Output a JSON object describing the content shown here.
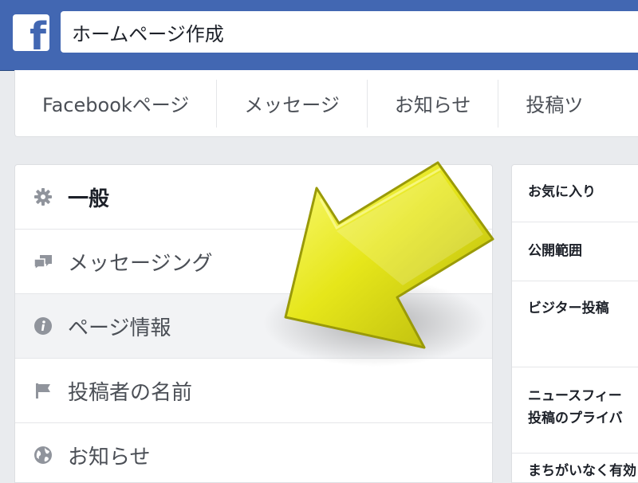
{
  "topbar": {
    "logo_letter": "f",
    "search_value": "ホームページ作成",
    "brand_color": "#4267b2"
  },
  "tabs": [
    {
      "label": "Facebookページ"
    },
    {
      "label": "メッセージ"
    },
    {
      "label": "お知らせ"
    },
    {
      "label": "投稿ツ"
    }
  ],
  "settings_menu": {
    "items": [
      {
        "label": "一般",
        "icon": "gear-icon"
      },
      {
        "label": "メッセージング",
        "icon": "chat-bubbles-icon"
      },
      {
        "label": "ページ情報",
        "icon": "info-icon"
      },
      {
        "label": "投稿者の名前",
        "icon": "flag-icon"
      },
      {
        "label": "お知らせ",
        "icon": "globe-icon"
      }
    ]
  },
  "settings_panel": {
    "rows": [
      {
        "label": "お気に入り"
      },
      {
        "label": "公開範囲"
      },
      {
        "label": "ビジター投稿"
      },
      {
        "label_line1": "ニュースフィー",
        "label_line2": "投稿のプライバ"
      },
      {
        "label": "まちがいなく有効"
      }
    ]
  },
  "overlay": {
    "arrow_color": "#e6e61a",
    "arrow_icon": "arrow-pointer-icon"
  }
}
